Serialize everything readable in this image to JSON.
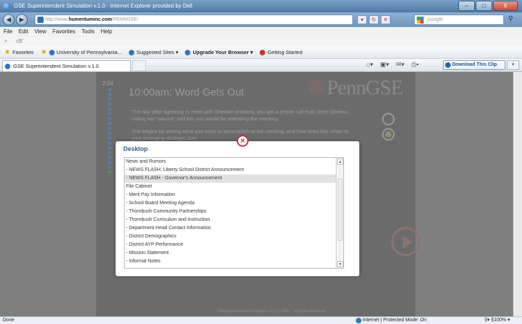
{
  "window": {
    "title": "GSE Superintendent Simulation v.1.0 - Internet Explorer provided by Dell",
    "controls": [
      "–",
      "□",
      "X"
    ]
  },
  "address": {
    "url_prefix": "http://www.",
    "url_host": "humentuminc.com",
    "url_path": "/PENNGSE/",
    "search_placeholder": "Google"
  },
  "menu": [
    "File",
    "Edit",
    "View",
    "Favorites",
    "Tools",
    "Help"
  ],
  "linksbar": {
    "close": "×",
    "label": "cB'"
  },
  "favorites": {
    "label": "Favorites",
    "items": [
      "University of Pennsylvania...",
      "Suggested Sites ▾",
      "Upgrade Your Browser ▾",
      "Getting Started"
    ]
  },
  "tab": {
    "title": "GSE Superintendent Simulation v.1.0"
  },
  "download_clip": "Download This Clip",
  "simulation": {
    "timer": "2:24",
    "title": "10:00am:  Word Gets Out",
    "logo": "PennGSE",
    "para1": "The day after agreeing to meet with Sheldon privately, you get a phone call from Jenn Oliviera, noting her \"source\" told her you would be attending the meeting.",
    "para2": "She begins by asking what you hope to accomplish at the meeting, and how does this relate to your emerging strategic plan.",
    "footer": "GSE Superintendent Simulation v.1.0   (c) 2009, ... All Rights Reserved",
    "progress_completed": 17,
    "progress_total": 18
  },
  "modal": {
    "title": "Desktop",
    "close": "×",
    "items": [
      {
        "label": "News and Rumors",
        "selected": false
      },
      {
        "label": "- NEWS FLASH:  Liberty School District Announcement",
        "selected": false
      },
      {
        "label": "- NEWS FLASH - Governor's Announcement",
        "selected": true
      },
      {
        "label": "File Cabinet",
        "selected": false
      },
      {
        "label": "- Merit Pay Information",
        "selected": false
      },
      {
        "label": "- School Board Meeting Agenda",
        "selected": false
      },
      {
        "label": "- Thornbush Community Partnerships",
        "selected": false
      },
      {
        "label": "- Thornbush Curriculum and Instruction",
        "selected": false
      },
      {
        "label": "- Department Head Contact Information",
        "selected": false
      },
      {
        "label": "- District Demographics",
        "selected": false
      },
      {
        "label": "- District AYP Performance",
        "selected": false
      },
      {
        "label": "- Mission Statement",
        "selected": false
      },
      {
        "label": "- Informal Notes",
        "selected": false
      }
    ]
  },
  "status": {
    "left": "Done",
    "zone": "Internet | Protected Mode: On",
    "zoom": "§▾  §100%  ▾"
  }
}
